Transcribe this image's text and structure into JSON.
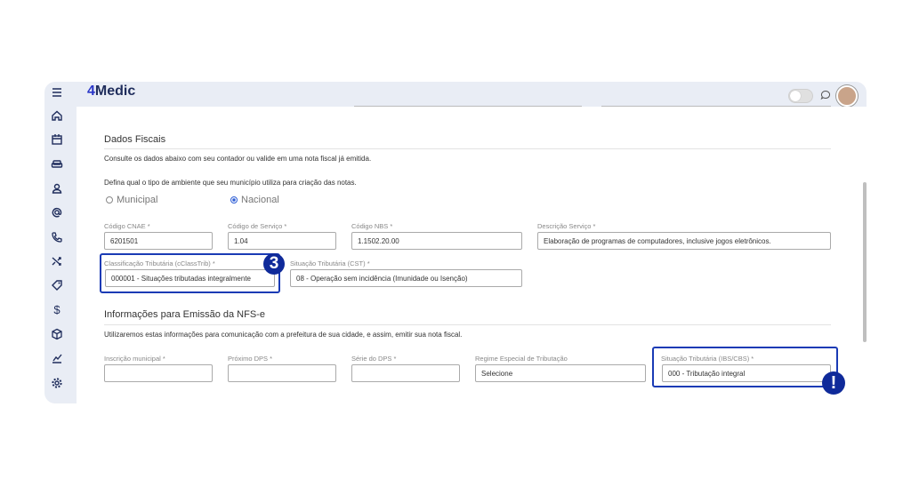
{
  "app": {
    "logo_prefix": "4",
    "logo_rest": "Medic"
  },
  "sidebar": {
    "items": [
      {
        "icon": "menu-icon"
      },
      {
        "icon": "home-icon"
      },
      {
        "icon": "calendar-icon"
      },
      {
        "icon": "sofa-icon"
      },
      {
        "icon": "user-icon"
      },
      {
        "icon": "at-icon"
      },
      {
        "icon": "phone-icon"
      },
      {
        "icon": "shuffle-icon"
      },
      {
        "icon": "tag-icon"
      },
      {
        "icon": "dollar-icon"
      },
      {
        "icon": "box-icon"
      },
      {
        "icon": "chart-icon"
      },
      {
        "icon": "settings-icon"
      }
    ]
  },
  "fiscal": {
    "title": "Dados Fiscais",
    "consult_text": "Consulte os dados abaixo com seu contador ou valide em uma nota fiscal já emitida.",
    "env_question": "Defina qual o tipo de ambiente que seu município utiliza para criação das notas.",
    "radio_municipal": "Municipal",
    "radio_nacional": "Nacional",
    "selected": "Nacional",
    "fields": {
      "cnae_label": "Código CNAE *",
      "cnae_value": "6201501",
      "servico_label": "Código de Serviço *",
      "servico_value": "1.04",
      "nbs_label": "Código NBS *",
      "nbs_value": "1.1502.20.00",
      "descricao_label": "Descrição Serviço *",
      "descricao_value": "Elaboração de programas de computadores, inclusive jogos eletrônicos.",
      "classtrib_label": "Classificação Tributária (cClassTrib) *",
      "classtrib_value": "000001 - Situações tributadas integralmente",
      "cst_label": "Situação Tributária (CST) *",
      "cst_value": "08 - Operação sem incidência (Imunidade ou Isenção)"
    }
  },
  "nfse": {
    "title": "Informações para Emissão da NFS-e",
    "desc": "Utilizaremos estas informações para comunicação com a prefeitura de sua cidade, e assim, emitir sua nota fiscal.",
    "inscricao_label": "Inscrição municipal *",
    "inscricao_value": "",
    "proximo_label": "Próximo DPS *",
    "proximo_value": "",
    "serie_label": "Série do DPS *",
    "serie_value": "",
    "regime_label": "Regime Especial de Tributação",
    "regime_value": "Selecione",
    "ibscbs_label": "Situação Tributária (IBS/CBS) *",
    "ibscbs_value": "000 - Tributação integral"
  },
  "badges": {
    "step": "3",
    "alert": "!"
  },
  "colors": {
    "accent": "#1a3bb5",
    "badge": "#0f2a9a",
    "frame": "#e9edf5"
  }
}
